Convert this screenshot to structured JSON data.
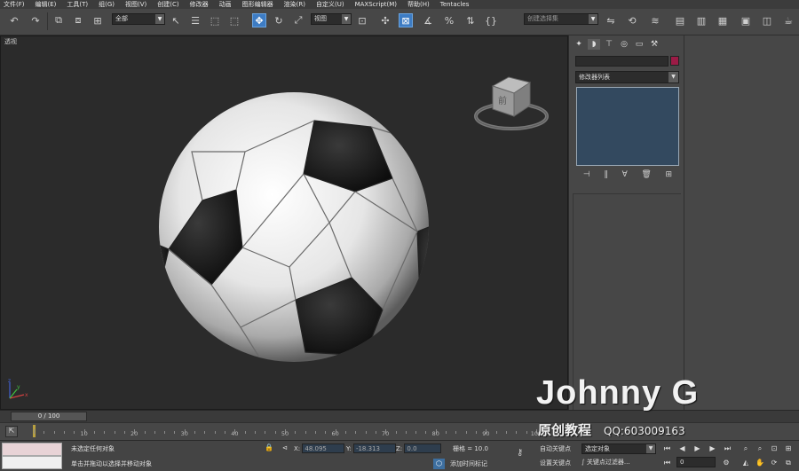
{
  "menu": [
    "文件(F)",
    "编辑(E)",
    "工具(T)",
    "组(G)",
    "视图(V)",
    "创建(C)",
    "修改器",
    "动画",
    "图形编辑器",
    "渲染(R)",
    "自定义(U)",
    "MAXScript(M)",
    "帮助(H)",
    "Tentacles"
  ],
  "toolbar": {
    "filter_value": "全部",
    "coord_system": "视图",
    "selection_set_placeholder": "创建选择集"
  },
  "viewport": {
    "label": "透视",
    "viewcube_text": "前"
  },
  "command_panel": {
    "object_name": "",
    "modifier_list_label": "修改器列表",
    "object_color": "#9c1b46"
  },
  "timeline": {
    "frame_display": "0 / 100",
    "ticks": [
      "10",
      "20",
      "30",
      "40",
      "50",
      "60",
      "70",
      "80",
      "90",
      "100"
    ]
  },
  "status": {
    "selection_text": "未选定任何对象",
    "prompt_text": "单击并拖动以选择并移动对象",
    "x_label": "X:",
    "x_value": "48.095",
    "y_label": "Y:",
    "y_value": "-18.313",
    "z_label": "Z:",
    "z_value": "0.0",
    "grid_text": "栅格 = 10.0",
    "add_time_tag": "添加时间标记",
    "auto_key": "自动关键点",
    "set_key": "设置关键点",
    "selected_objects": "选定对象",
    "key_filters": "关键点过滤器...",
    "frame_value": "0"
  },
  "watermark": {
    "title": "Johnny G",
    "subtitle": "原创教程",
    "qq": "QQ:603009163"
  }
}
